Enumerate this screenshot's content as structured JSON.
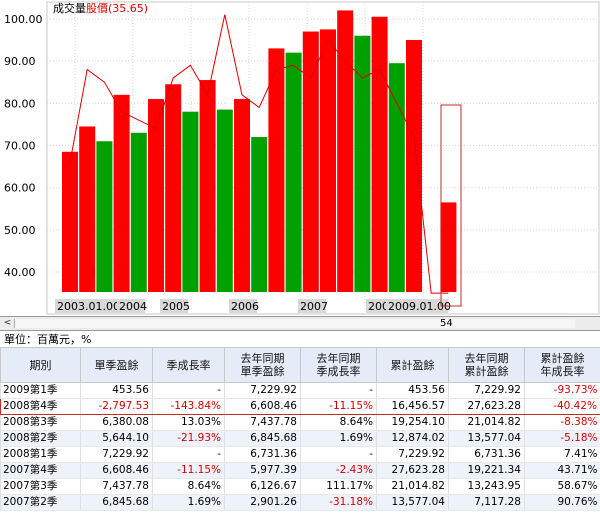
{
  "legend": {
    "volume_label": "成交量",
    "price_label": "股價(35.65)",
    "price_color": "#e00000"
  },
  "chart_data": {
    "type": "bar",
    "y_ticks": [
      "100.00",
      "90.00",
      "80.00",
      "70.00",
      "60.00",
      "50.00",
      "40.00"
    ],
    "ylim": [
      31,
      104
    ],
    "x_tick_labels": [
      "2003.01.00",
      "2004",
      "2005",
      "2006",
      "2007",
      "2008",
      "2009.01.00"
    ],
    "bars": [
      {
        "value": 68.5,
        "color": "red"
      },
      {
        "value": 74.5,
        "color": "red"
      },
      {
        "value": 71.0,
        "color": "green"
      },
      {
        "value": 82.0,
        "color": "red"
      },
      {
        "value": 73.0,
        "color": "green"
      },
      {
        "value": 81.0,
        "color": "red"
      },
      {
        "value": 84.5,
        "color": "red"
      },
      {
        "value": 78.0,
        "color": "green"
      },
      {
        "value": 85.5,
        "color": "red"
      },
      {
        "value": 78.5,
        "color": "green"
      },
      {
        "value": 81.0,
        "color": "red"
      },
      {
        "value": 72.0,
        "color": "green"
      },
      {
        "value": 93.0,
        "color": "red"
      },
      {
        "value": 92.0,
        "color": "green"
      },
      {
        "value": 97.0,
        "color": "red"
      },
      {
        "value": 97.5,
        "color": "red"
      },
      {
        "value": 102.0,
        "color": "red"
      },
      {
        "value": 96.0,
        "color": "green"
      },
      {
        "value": 100.5,
        "color": "red"
      },
      {
        "value": 89.5,
        "color": "green"
      },
      {
        "value": 95.0,
        "color": "red"
      },
      {
        "value": 33.0,
        "color": "green"
      },
      {
        "value": 56.5,
        "color": "red"
      }
    ],
    "price_line": [
      66,
      88,
      85,
      78,
      76,
      74,
      86,
      89,
      82,
      101,
      82,
      79,
      88,
      89,
      86,
      95,
      90,
      86,
      88,
      80,
      72,
      35,
      35
    ],
    "colors": {
      "up": "#ff0000",
      "down": "#00a000"
    }
  },
  "scrollbar": {
    "left_arrow": "<",
    "value": "54"
  },
  "unit_label": "單位：百萬元，%",
  "table": {
    "headers": [
      [
        "期別"
      ],
      [
        "單季盈餘"
      ],
      [
        "季成長率"
      ],
      [
        "去年同期",
        "單季盈餘"
      ],
      [
        "去年同期",
        "季成長率"
      ],
      [
        "累計盈餘"
      ],
      [
        "去年同期",
        "累計盈餘"
      ],
      [
        "累計盈餘",
        "年成長率"
      ]
    ],
    "rows": [
      {
        "cells": [
          "2009第1季",
          "453.56",
          "-",
          "7,229.92",
          "-",
          "453.56",
          "7,229.92",
          "-93.73%"
        ],
        "neg": [
          7
        ]
      },
      {
        "cells": [
          "2008第4季",
          "-2,797.53",
          "-143.84%",
          "6,608.46",
          "-11.15%",
          "16,456.57",
          "27,623.28",
          "-40.42%"
        ],
        "neg": [
          1,
          2,
          4,
          7
        ]
      },
      {
        "cells": [
          "2008第3季",
          "6,380.08",
          "13.03%",
          "7,437.78",
          "8.64%",
          "19,254.10",
          "21,014.82",
          "-8.38%"
        ],
        "neg": [
          7
        ]
      },
      {
        "cells": [
          "2008第2季",
          "5,644.10",
          "-21.93%",
          "6,845.68",
          "1.69%",
          "12,874.02",
          "13,577.04",
          "-5.18%"
        ],
        "neg": [
          2,
          7
        ]
      },
      {
        "cells": [
          "2008第1季",
          "7,229.92",
          "-",
          "6,731.36",
          "-",
          "7,229.92",
          "6,731.36",
          "7.41%"
        ],
        "neg": []
      },
      {
        "cells": [
          "2007第4季",
          "6,608.46",
          "-11.15%",
          "5,977.39",
          "-2.43%",
          "27,623.28",
          "19,221.34",
          "43.71%"
        ],
        "neg": [
          2,
          4
        ]
      },
      {
        "cells": [
          "2007第3季",
          "7,437.78",
          "8.64%",
          "6,126.67",
          "111.17%",
          "21,014.82",
          "13,243.95",
          "58.67%"
        ],
        "neg": []
      },
      {
        "cells": [
          "2007第2季",
          "6,845.68",
          "1.69%",
          "2,901.26",
          "-31.18%",
          "13,577.04",
          "7,117.28",
          "90.76%"
        ],
        "neg": [
          4
        ]
      }
    ]
  }
}
